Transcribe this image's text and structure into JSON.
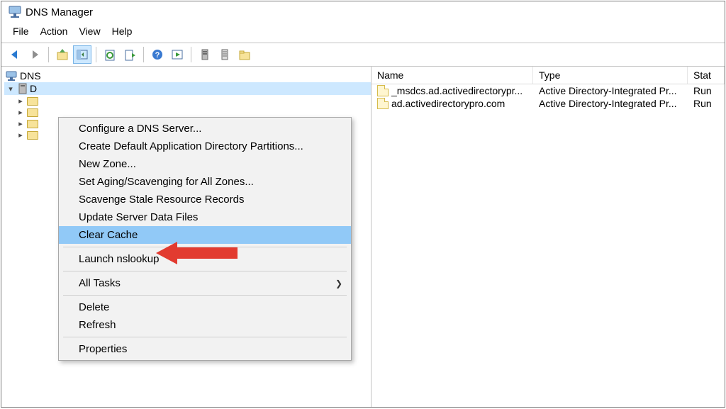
{
  "window": {
    "title": "DNS Manager"
  },
  "menubar": {
    "file": "File",
    "action": "Action",
    "view": "View",
    "help": "Help"
  },
  "tree": {
    "root_label": "DNS",
    "selected_partial": "D"
  },
  "listheader": {
    "name": "Name",
    "type": "Type",
    "stat": "Stat"
  },
  "zones": [
    {
      "name": "_msdcs.ad.activedirectorypr...",
      "type": "Active Directory-Integrated Pr...",
      "stat": "Run"
    },
    {
      "name": "ad.activedirectorypro.com",
      "type": "Active Directory-Integrated Pr...",
      "stat": "Run"
    }
  ],
  "context_menu": {
    "items": [
      {
        "label": "Configure a DNS Server..."
      },
      {
        "label": "Create Default Application Directory Partitions..."
      },
      {
        "label": "New Zone..."
      },
      {
        "label": "Set Aging/Scavenging for All Zones..."
      },
      {
        "label": "Scavenge Stale Resource Records"
      },
      {
        "label": "Update Server Data Files"
      },
      {
        "label": "Clear Cache",
        "highlight": true
      },
      {
        "sep": true
      },
      {
        "label": "Launch nslookup"
      },
      {
        "sep": true
      },
      {
        "label": "All Tasks",
        "submenu": true
      },
      {
        "sep": true
      },
      {
        "label": "Delete"
      },
      {
        "label": "Refresh"
      },
      {
        "sep": true
      },
      {
        "label": "Properties"
      }
    ],
    "submenu_glyph": "❯"
  }
}
